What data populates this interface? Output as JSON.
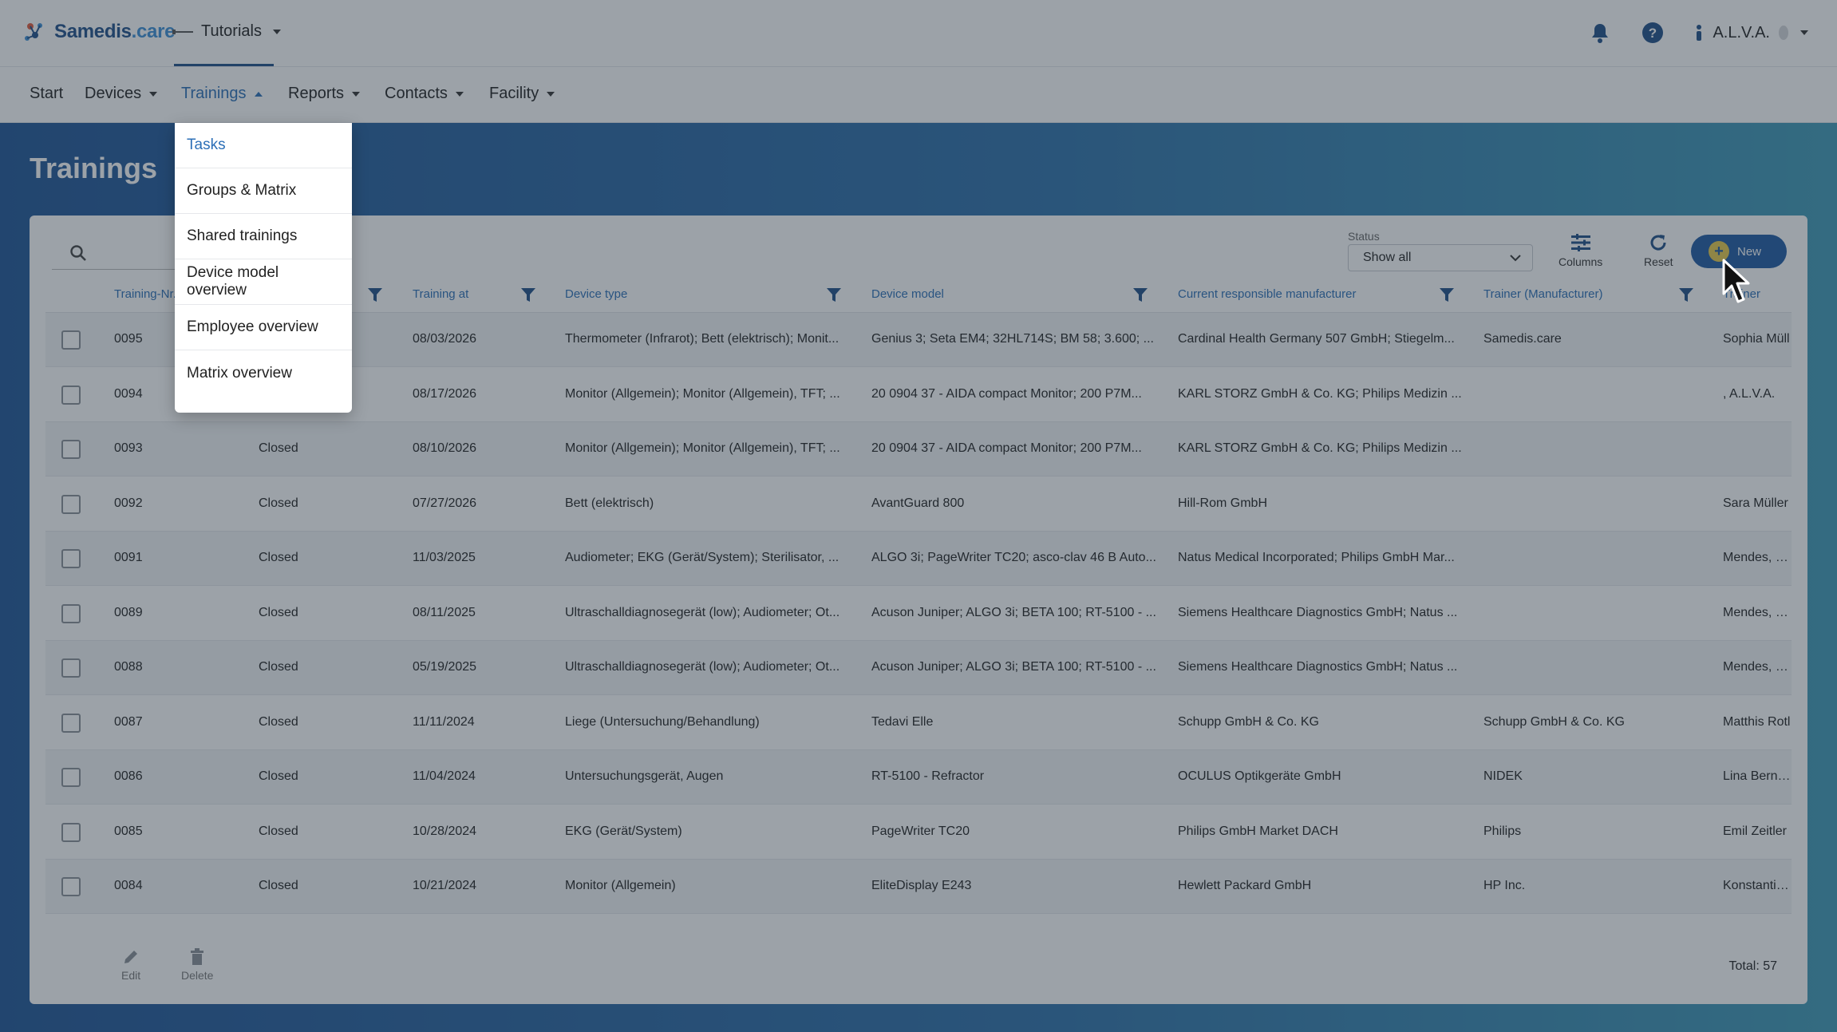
{
  "header": {
    "logo_main": "Samedis",
    "logo_suffix": ".care",
    "tenant": "Tutorials",
    "user": "A.L.V.A."
  },
  "nav": {
    "items": [
      {
        "label": "Start"
      },
      {
        "label": "Devices"
      },
      {
        "label": "Trainings"
      },
      {
        "label": "Reports"
      },
      {
        "label": "Contacts"
      },
      {
        "label": "Facility"
      }
    ]
  },
  "trainings_menu": {
    "items": [
      {
        "label": "Tasks"
      },
      {
        "label": "Groups & Matrix"
      },
      {
        "label": "Shared trainings"
      },
      {
        "label": "Device model overview"
      },
      {
        "label": "Employee overview"
      },
      {
        "label": "Matrix overview"
      }
    ]
  },
  "page": {
    "title": "Trainings"
  },
  "toolbar": {
    "status_label": "Status",
    "status_value": "Show all",
    "columns_label": "Columns",
    "reset_label": "Reset",
    "new_label": "New"
  },
  "table": {
    "columns": [
      "Training-Nr.",
      "Training at",
      "Device type",
      "Device model",
      "Current responsible manufacturer",
      "Trainer (Manufacturer)",
      "Trainer"
    ],
    "rows": [
      {
        "nr": "0095",
        "status": "",
        "date": "08/03/2026",
        "type": "Thermometer (Infrarot); Bett (elektrisch); Monit...",
        "model": "Genius 3; Seta EM4; 32HL714S; BM 58; 3.600; ...",
        "manufacturer": "Cardinal Health Germany 507 GmbH; Stiegelm...",
        "trainer_mfr": "Samedis.care",
        "trainer": "Sophia Müll"
      },
      {
        "nr": "0094",
        "status": "",
        "date": "08/17/2026",
        "type": "Monitor (Allgemein); Monitor (Allgemein), TFT; ...",
        "model": "20 0904 37 - AIDA compact Monitor; 200 P7M...",
        "manufacturer": "KARL STORZ GmbH & Co. KG; Philips Medizin ...",
        "trainer_mfr": "",
        "trainer": ", A.L.V.A."
      },
      {
        "nr": "0093",
        "status": "Closed",
        "date": "08/10/2026",
        "type": "Monitor (Allgemein); Monitor (Allgemein), TFT; ...",
        "model": "20 0904 37 - AIDA compact Monitor; 200 P7M...",
        "manufacturer": "KARL STORZ GmbH & Co. KG; Philips Medizin ...",
        "trainer_mfr": "",
        "trainer": ""
      },
      {
        "nr": "0092",
        "status": "Closed",
        "date": "07/27/2026",
        "type": "Bett (elektrisch)",
        "model": "AvantGuard 800",
        "manufacturer": "Hill-Rom GmbH",
        "trainer_mfr": "",
        "trainer": "Sara Müller"
      },
      {
        "nr": "0091",
        "status": "Closed",
        "date": "11/03/2025",
        "type": "Audiometer; EKG (Gerät/System); Sterilisator, ...",
        "model": "ALGO 3i; PageWriter TC20; asco-clav 46 B Auto...",
        "manufacturer": "Natus Medical Incorporated; Philips GmbH Mar...",
        "trainer_mfr": "",
        "trainer": "Mendes, Kia"
      },
      {
        "nr": "0089",
        "status": "Closed",
        "date": "08/11/2025",
        "type": "Ultraschalldiagnosegerät (low); Audiometer; Ot...",
        "model": "Acuson Juniper; ALGO 3i; BETA 100; RT-5100 - ...",
        "manufacturer": "Siemens Healthcare Diagnostics GmbH; Natus ...",
        "trainer_mfr": "",
        "trainer": "Mendes, Kia"
      },
      {
        "nr": "0088",
        "status": "Closed",
        "date": "05/19/2025",
        "type": "Ultraschalldiagnosegerät (low); Audiometer; Ot...",
        "model": "Acuson Juniper; ALGO 3i; BETA 100; RT-5100 - ...",
        "manufacturer": "Siemens Healthcare Diagnostics GmbH; Natus ...",
        "trainer_mfr": "",
        "trainer": "Mendes, Kia"
      },
      {
        "nr": "0087",
        "status": "Closed",
        "date": "11/11/2024",
        "type": "Liege (Untersuchung/Behandlung)",
        "model": "Tedavi Elle",
        "manufacturer": "Schupp GmbH & Co. KG",
        "trainer_mfr": "Schupp GmbH & Co. KG",
        "trainer": "Matthis Rotl"
      },
      {
        "nr": "0086",
        "status": "Closed",
        "date": "11/04/2024",
        "type": "Untersuchungsgerät, Augen",
        "model": "RT-5100 - Refractor",
        "manufacturer": "OCULUS Optikgeräte GmbH",
        "trainer_mfr": "NIDEK",
        "trainer": "Lina Bernste"
      },
      {
        "nr": "0085",
        "status": "Closed",
        "date": "10/28/2024",
        "type": "EKG (Gerät/System)",
        "model": "PageWriter TC20",
        "manufacturer": "Philips GmbH Market DACH",
        "trainer_mfr": "Philips",
        "trainer": "Emil Zeitler"
      },
      {
        "nr": "0084",
        "status": "Closed",
        "date": "10/21/2024",
        "type": "Monitor (Allgemein)",
        "model": "EliteDisplay E243",
        "manufacturer": "Hewlett Packard GmbH",
        "trainer_mfr": "HP Inc.",
        "trainer": "Konstantin V"
      }
    ]
  },
  "footer": {
    "edit_label": "Edit",
    "delete_label": "Delete",
    "total": "Total: 57"
  },
  "colors": {
    "brand": "#1f4f8a",
    "accent": "#2c6fb7",
    "new_button": "#1e5aa3"
  }
}
